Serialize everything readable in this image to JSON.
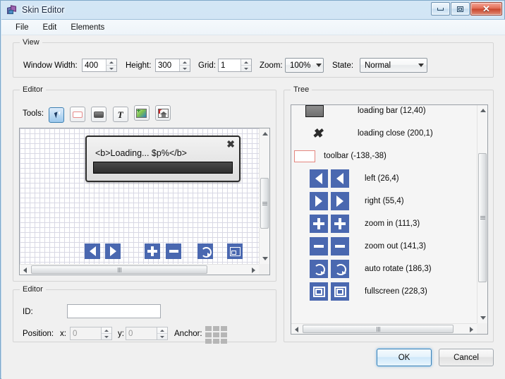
{
  "window": {
    "title": "Skin Editor",
    "icon": "skin-editor-icon",
    "controls": {
      "minimize": "minimize-icon",
      "maximize": "maximize-icon",
      "close": "close-icon"
    }
  },
  "menubar": {
    "items": [
      "File",
      "Edit",
      "Elements"
    ]
  },
  "view": {
    "legend": "View",
    "window_width_label": "Window Width:",
    "window_width_value": "400",
    "height_label": "Height:",
    "height_value": "300",
    "grid_label": "Grid:",
    "grid_value": "1",
    "zoom_label": "Zoom:",
    "zoom_value": "100%",
    "state_label": "State:",
    "state_value": "Normal"
  },
  "editor": {
    "legend": "Editor",
    "tools_label": "Tools:",
    "tools": [
      {
        "name": "cursor-tool",
        "selected": true
      },
      {
        "name": "rectangle-tool",
        "selected": false
      },
      {
        "name": "panel-tool",
        "selected": false
      },
      {
        "name": "text-tool",
        "selected": false
      },
      {
        "name": "image-add-tool",
        "selected": false
      },
      {
        "name": "image-home-tool",
        "selected": false
      }
    ],
    "canvas": {
      "loading_dialog_text": "<b>Loading... $p%</b>",
      "loading_close": "✖",
      "toolbar_icons": [
        "left",
        "right",
        "zoom-in",
        "zoom-out",
        "auto-rotate",
        "fullscreen"
      ]
    }
  },
  "tree": {
    "legend": "Tree",
    "items": [
      {
        "label": "loading bar (12,40)",
        "icon": "grey-bar",
        "count": 1
      },
      {
        "label": "loading close (200,1)",
        "icon": "x-mark",
        "count": 1
      },
      {
        "label": "toolbar (-138,-38)",
        "icon": "red-rect",
        "count": 1
      },
      {
        "label": "left (26,4)",
        "icon": "arrow-left",
        "count": 2
      },
      {
        "label": "right (55,4)",
        "icon": "arrow-right",
        "count": 2
      },
      {
        "label": "zoom in (111,3)",
        "icon": "plus",
        "count": 2
      },
      {
        "label": "zoom out (141,3)",
        "icon": "minus",
        "count": 2
      },
      {
        "label": "auto rotate (186,3)",
        "icon": "rotate",
        "count": 2
      },
      {
        "label": "fullscreen (228,3)",
        "icon": "fullscreen",
        "count": 2
      }
    ]
  },
  "properties": {
    "legend": "Editor",
    "id_label": "ID:",
    "id_value": "",
    "position_label": "Position:",
    "x_label": "x:",
    "x_value": "0",
    "y_label": "y:",
    "y_value": "0",
    "anchor_label": "Anchor:"
  },
  "footer": {
    "ok_label": "OK",
    "cancel_label": "Cancel"
  },
  "colors": {
    "accent_blue": "#4a68b0",
    "title_gradient_top": "#d3e6f5",
    "close_button_red": "#c8452c",
    "selection_blue": "#3c7fb1"
  }
}
